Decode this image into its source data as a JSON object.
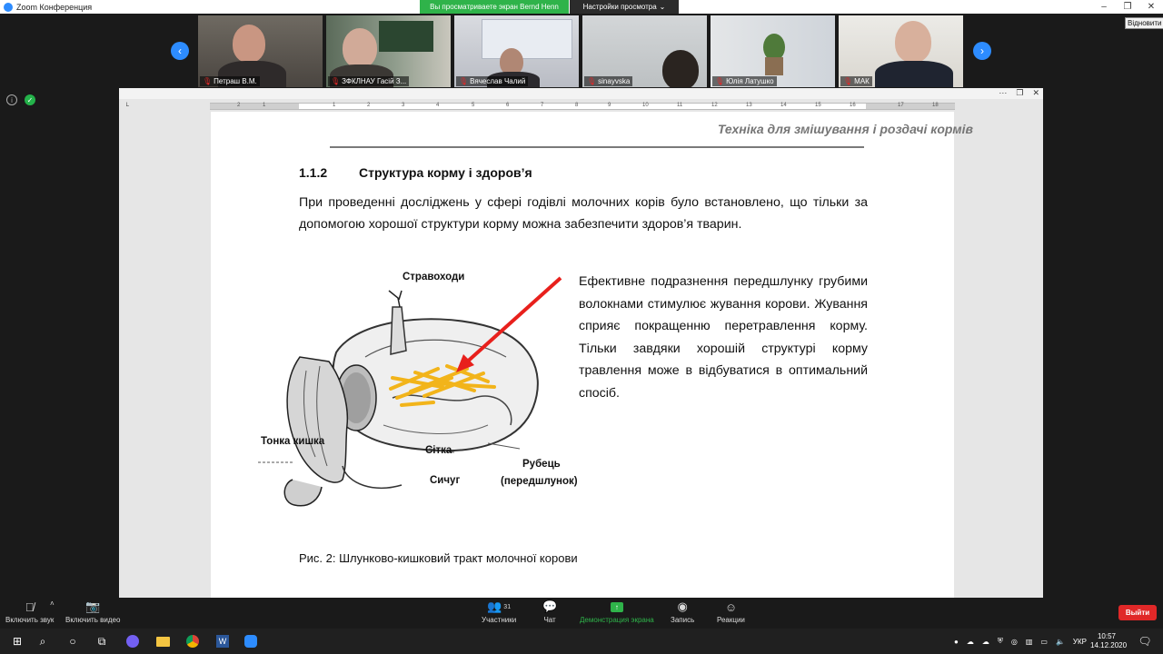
{
  "window": {
    "app_title": "Zoom Конференция",
    "share_banner": "Вы просматриваете экран Bernd Henn",
    "view_options": "Настройки просмотра",
    "restore_tooltip": "Відновити"
  },
  "participants": [
    {
      "name": "Петраш В.М."
    },
    {
      "name": "ЗФКЛНАУ Гасій З..."
    },
    {
      "name": "Вячеслав Чалий"
    },
    {
      "name": "sinayvska"
    },
    {
      "name": "Юлія Латушко"
    },
    {
      "name": "МАК"
    }
  ],
  "document": {
    "ruler_numbers": [
      "2",
      "1",
      "1",
      "2",
      "3",
      "4",
      "5",
      "6",
      "7",
      "8",
      "9",
      "10",
      "11",
      "12",
      "13",
      "14",
      "15",
      "16",
      "17",
      "18"
    ],
    "header": "Техніка для змішування і роздачі кормів",
    "section_number": "1.1.2",
    "section_title": "Структура корму і здоров’я",
    "intro": "При проведенні досліджень у сфері годівлі молочних корів було встановлено, що тільки за допомогою хорошої структури корму можна забезпечити здоров’я тварин.",
    "side_text": "Ефективне подразнення передшлунку грубими волокнами стимулює жування корови. Жування сприяє покращенню перетравлення корму. Тільки завдяки хорошій структурі корму травлення може в відбуватися в оптимальний спосіб.",
    "figure_labels": {
      "esophagus": "Стравоходи",
      "small_intestine": "Тонка кишка",
      "reticulum": "Сітка",
      "abomasum": "Сичуг",
      "rumen": "Рубець",
      "rumen_sub": "(передшлунок)"
    },
    "caption": "Рис. 2: Шлунково-кишковий тракт молочної корови"
  },
  "toolbar": {
    "unmute": "Включить звук",
    "start_video": "Включить видео",
    "participants": "Участники",
    "participants_count": "31",
    "chat": "Чат",
    "share_screen": "Демонстрация экрана",
    "record": "Запись",
    "reactions": "Реакции",
    "leave": "Выйти"
  },
  "taskbar": {
    "language": "УКР",
    "time": "10:57",
    "date": "14.12.2020"
  },
  "colors": {
    "zoom_blue": "#2d8cff",
    "share_green": "#2fb34a",
    "leave_red": "#e02828",
    "arrow_red": "#e8201c",
    "straw_yellow": "#f2b41a"
  }
}
